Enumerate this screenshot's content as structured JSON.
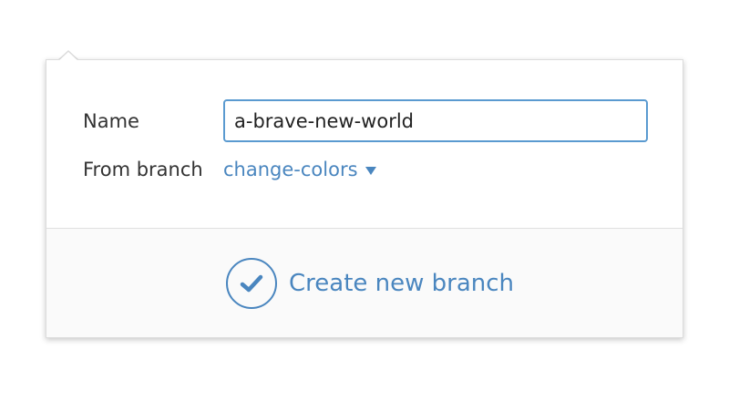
{
  "form": {
    "name_label": "Name",
    "name_value": "a-brave-new-world",
    "from_label": "From branch",
    "from_branch": "change-colors"
  },
  "actions": {
    "create_label": "Create new branch"
  },
  "colors": {
    "accent": "#4a86bf",
    "input_border": "#5a9ad0",
    "footer_bg": "#fafafa"
  },
  "icons": {
    "caret": "caret-down-icon",
    "check": "check-icon"
  }
}
